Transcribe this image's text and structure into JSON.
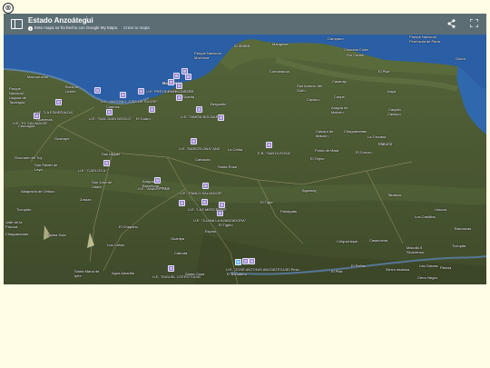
{
  "window": {
    "close_glyph": "⊗"
  },
  "header": {
    "title": "Estado Anzoátegui",
    "subtitle": "Este mapa se ha hecho con Google My Maps.",
    "create_link": "Crear tu mapa"
  },
  "colors": {
    "header_bg": "#5c6e74",
    "marker": "#8e7cc3",
    "marker_active": "#57b0ff",
    "sea": "#2a5fa5"
  },
  "map": {
    "places": [
      {
        "name": "Cumaná",
        "cls": ""
      },
      {
        "name": "Mariguitar",
        "cls": "small"
      },
      {
        "name": "Carúpano",
        "cls": "small"
      },
      {
        "name": "Parque Nacional Península de Paria",
        "cls": "small"
      },
      {
        "name": "Cristobal Colón",
        "cls": "small"
      },
      {
        "name": "Río Caribe",
        "cls": "small"
      },
      {
        "name": "El Pilar",
        "cls": "small"
      },
      {
        "name": "Guiria",
        "cls": "small"
      },
      {
        "name": "Parque Nacional Mochima",
        "cls": "small"
      },
      {
        "name": "Cumanacoa",
        "cls": "small"
      },
      {
        "name": "San Antonio del Golfo",
        "cls": "small"
      },
      {
        "name": "Cariaco",
        "cls": "small"
      },
      {
        "name": "Casanay",
        "cls": "small"
      },
      {
        "name": "Irapa",
        "cls": "small"
      },
      {
        "name": "Machurucuto",
        "cls": "small"
      },
      {
        "name": "Boca de Uchire",
        "cls": "small"
      },
      {
        "name": "Barcelona",
        "cls": ""
      },
      {
        "name": "Puerto La Cruz",
        "cls": "small"
      },
      {
        "name": "Bergantín",
        "cls": "small"
      },
      {
        "name": "Caripe",
        "cls": "small"
      },
      {
        "name": "Caripito",
        "cls": "small"
      },
      {
        "name": "Aragua de Maturín",
        "cls": "small"
      },
      {
        "name": "Parque Nacional Laguna de Tacarigua",
        "cls": "small"
      },
      {
        "name": "Clarines",
        "cls": "small"
      },
      {
        "name": "Guanta",
        "cls": "small"
      },
      {
        "name": "El Guaro",
        "cls": "small"
      },
      {
        "name": "Chaguaramas",
        "cls": "small"
      },
      {
        "name": "La Toscana",
        "cls": "small"
      },
      {
        "name": "Guarenas",
        "cls": "small"
      },
      {
        "name": "Caucagua",
        "cls": "small"
      },
      {
        "name": "Guanape",
        "cls": "small"
      },
      {
        "name": "Caicara de Maturín",
        "cls": "small"
      },
      {
        "name": "Maturín",
        "cls": ""
      },
      {
        "name": "Punta de Mata",
        "cls": "small"
      },
      {
        "name": "El Corozo",
        "cls": "small"
      },
      {
        "name": "El Tejero",
        "cls": "small"
      },
      {
        "name": "Ocumare del Tuy",
        "cls": "small"
      },
      {
        "name": "San Miguel",
        "cls": "small"
      },
      {
        "name": "Cantaura",
        "cls": "small"
      },
      {
        "name": "Santa Rosa",
        "cls": "small"
      },
      {
        "name": "La Ceiba",
        "cls": "small"
      },
      {
        "name": "San Rafael de Laya",
        "cls": "small"
      },
      {
        "name": "Altagracia de Orituco",
        "cls": "small"
      },
      {
        "name": "Anaco",
        "cls": "small"
      },
      {
        "name": "San José de Unare",
        "cls": "small"
      },
      {
        "name": "Zaraza",
        "cls": "small"
      },
      {
        "name": "Aragua de Barcelona",
        "cls": "small"
      },
      {
        "name": "Aguasay",
        "cls": "small"
      },
      {
        "name": "Tucupido",
        "cls": "small"
      },
      {
        "name": "Tabasca",
        "cls": "small"
      },
      {
        "name": "Uracoa",
        "cls": "small"
      },
      {
        "name": "Barrancas",
        "cls": "small"
      },
      {
        "name": "Los Castillos",
        "cls": "small"
      },
      {
        "name": "Pariaguán",
        "cls": "small"
      },
      {
        "name": "El Tigre",
        "cls": "small"
      },
      {
        "name": "Valle de la Pascua",
        "cls": "small"
      },
      {
        "name": "Chaguaramas",
        "cls": "small"
      },
      {
        "name": "El Chaparro",
        "cls": "small"
      },
      {
        "name": "El Tigrito",
        "cls": "small"
      },
      {
        "name": "Espino",
        "cls": "small"
      },
      {
        "name": "Palma Sola",
        "cls": "small"
      },
      {
        "name": "Los Caños",
        "cls": "small"
      },
      {
        "name": "Guanipa",
        "cls": "small"
      },
      {
        "name": "Chiquichique",
        "cls": "small"
      },
      {
        "name": "Casacoima",
        "cls": "small"
      },
      {
        "name": "Macolla 5 Sinovensa",
        "cls": "small"
      },
      {
        "name": "Tucupita",
        "cls": "small"
      },
      {
        "name": "Cabruta",
        "cls": "small"
      },
      {
        "name": "Santa María de Ipire",
        "cls": "small"
      },
      {
        "name": "Agua Amarilla",
        "cls": "small"
      },
      {
        "name": "Santa Clara",
        "cls": "small"
      },
      {
        "name": "El Pinto",
        "cls": "small"
      },
      {
        "name": "El Pilar",
        "cls": "small"
      },
      {
        "name": "El Peñón",
        "cls": "small"
      },
      {
        "name": "Sierra Imataca",
        "cls": "small"
      },
      {
        "name": "Piacoa",
        "cls": "small"
      },
      {
        "name": "Cerro Negro",
        "cls": "small"
      },
      {
        "name": "Las Garzas",
        "cls": "small"
      },
      {
        "name": "Cachipo",
        "cls": "small"
      },
      {
        "name": "El Bañadero",
        "cls": "small"
      }
    ],
    "marker_labels": [
      "U.E. PRESIDENTE CORTÉS",
      "U.E. \"ANTONIO JOSÉ DE SUCRE\"",
      "U.E. \"LA ESMERALDA\"",
      "U.E. \"SAN JUAN BOSCO\"",
      "U.E. \"EL SALVADOR\"",
      "U.E. \"SIMÓN BOLÍVAR\"",
      "U.E. \"BARCELONA\" ANZ",
      "E.B. \"SANTA ROSA\"",
      "U.E. \"CARLOS A.\"",
      "U.E. \"ANACO\" BNE",
      "U.E. \"PABLO SALVADOR\"",
      "U.E. \"LAS MERCEDES\"",
      "U.E. \"JUANA LA AVANZADORA\"",
      "U.E. \"JOSÉ ANTONIO ANZOÁTEGUI\"",
      "U.E. \"MIGUEL OTERO SILVA\""
    ]
  }
}
